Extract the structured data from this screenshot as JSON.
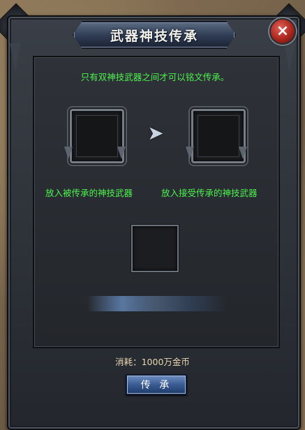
{
  "window": {
    "title": "武器神技传承",
    "close_label": "×"
  },
  "panel": {
    "hint": "只有双神技武器之间才可以铭文传承。",
    "source_slot_label": "放入被传承的神技武器",
    "target_slot_label": "放入接受传承的神技武器",
    "arrow_glyph": "➤",
    "progress": 0.5
  },
  "footer": {
    "cost_text": "消耗：1000万金币",
    "transfer_button": "传 承"
  },
  "colors": {
    "hint_text": "#4cf24c",
    "cost_text": "#e8d7b0",
    "close_button": "#b02a20",
    "transfer_button": "#3a5c94"
  }
}
